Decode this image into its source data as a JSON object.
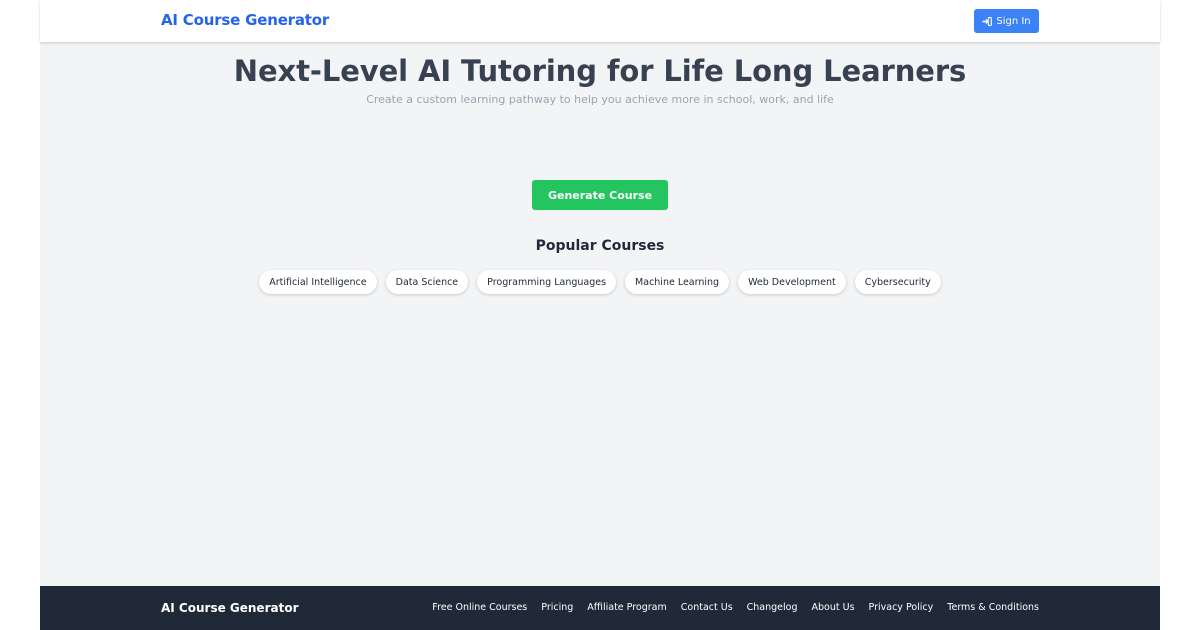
{
  "header": {
    "brand": "AI Course Generator",
    "signin_label": "Sign In",
    "signin_icon": "sign-in-icon"
  },
  "hero": {
    "title": "Next-Level AI Tutoring for Life Long Learners",
    "subtitle": "Create a custom learning pathway to help you achieve more in school, work, and life"
  },
  "generate": {
    "label": "Generate Course"
  },
  "popular": {
    "title": "Popular Courses",
    "courses": [
      "Artificial Intelligence",
      "Data Science",
      "Programming Languages",
      "Machine Learning",
      "Web Development",
      "Cybersecurity"
    ]
  },
  "footer": {
    "brand": "AI Course Generator",
    "links": [
      "Free Online Courses",
      "Pricing",
      "Affiliate Program",
      "Contact Us",
      "Changelog",
      "About Us",
      "Privacy Policy",
      "Terms & Conditions"
    ]
  },
  "colors": {
    "brand_blue": "#2563eb",
    "signin_bg": "#3b82f6",
    "generate_bg": "#22c55e",
    "page_bg": "#f3f4f6",
    "footer_bg": "#1f2937",
    "title_text": "#374151",
    "subtitle_text": "#9ca3af"
  }
}
